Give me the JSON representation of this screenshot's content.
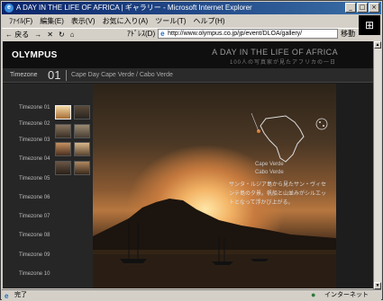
{
  "window": {
    "title": "A DAY IN THE LIFE OF AFRICA | ギャラリー - Microsoft Internet Explorer",
    "controls": [
      "_",
      "□",
      "×"
    ]
  },
  "menubar": {
    "items": [
      "ﾌｧｲﾙ(F)",
      "編集(E)",
      "表示(V)",
      "お気に入り(A)",
      "ツール(T)",
      "ヘルプ(H)"
    ]
  },
  "toolbar": {
    "back_label": "← 戻る",
    "forward_label": "→",
    "stop_label": "✕",
    "refresh_label": "↻",
    "home_label": "⌂"
  },
  "address": {
    "label": "ｱﾄﾞﾚｽ(D)",
    "url": "http://www.olympus.co.jp/jp/event/DLOA/gallery/",
    "go_label": "移動"
  },
  "site": {
    "brand": "OLYMPUS",
    "title": "A DAY IN THE LIFE OF AFRICA",
    "subtitle": "100人の写真家が見たアフリカの一日"
  },
  "timezone_bar": {
    "label": "Timezone",
    "number": "01",
    "description": "Cape Day Cape Verde / Cabo Verde"
  },
  "timezones": [
    "Timezone 01",
    "Timezone 02",
    "Timezone 03",
    "Timezone 04",
    "Timezone 05",
    "Timezone 06",
    "Timezone 07",
    "Timezone 08",
    "Timezone 09",
    "Timezone 10"
  ],
  "location": {
    "country": "Cape Verde",
    "city": "Cabo Verde"
  },
  "info_text": "サンタ・ルジア島から見たサン・ヴィセンテ島の夕景。帆船と山並みがシルエットとなって浮かび上がる。",
  "status": {
    "left_text": "完了",
    "right_text": "インターネット"
  }
}
